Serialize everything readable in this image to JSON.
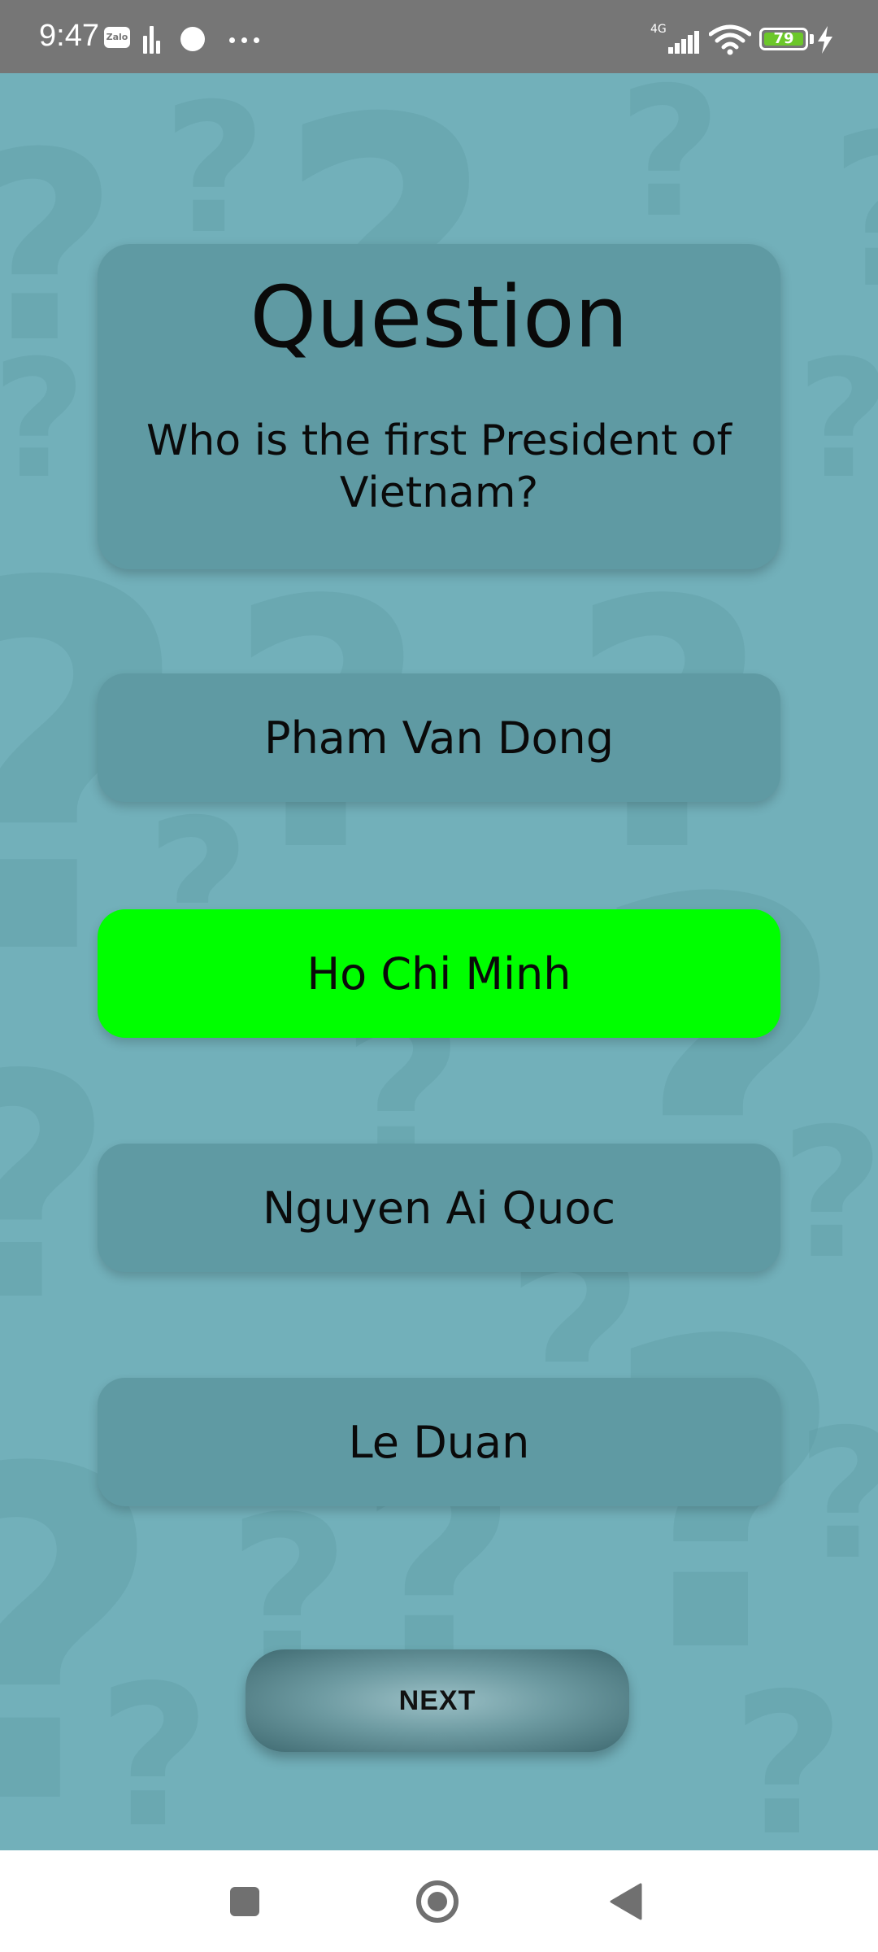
{
  "status_bar": {
    "time": "9:47",
    "app_icon_label": "Zalo",
    "network_label": "4G",
    "battery_level": "79",
    "icons": [
      "zalo-icon",
      "equalizer-icon",
      "circle-icon",
      "more-icon",
      "signal-icon",
      "wifi-icon",
      "battery-icon",
      "charging-icon"
    ]
  },
  "quiz": {
    "title": "Question",
    "question": "Who is the first President of Vietnam?",
    "answers": [
      {
        "label": "Pham Van Dong",
        "state": "normal"
      },
      {
        "label": "Ho Chi Minh",
        "state": "correct"
      },
      {
        "label": "Nguyen Ai Quoc",
        "state": "normal"
      },
      {
        "label": "Le Duan",
        "state": "normal"
      }
    ],
    "next_label": "NEXT"
  },
  "colors": {
    "background": "#72b0ba",
    "card": "#5f9aa3",
    "correct": "#00ff00",
    "status_bar": "#767676"
  },
  "nav_bar": {
    "icons": [
      "recent-apps-icon",
      "home-icon",
      "back-icon"
    ]
  }
}
